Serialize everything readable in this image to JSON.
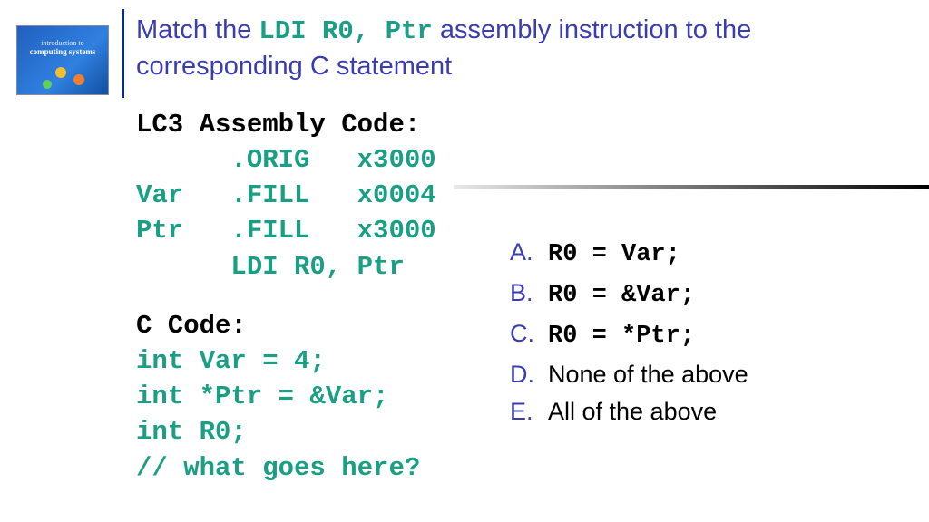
{
  "thumbnail": {
    "line1": "introduction to",
    "line2": "computing systems"
  },
  "heading": {
    "prefix": "Match the ",
    "code": "LDI R0, Ptr",
    "suffix": " assembly instruction to the corresponding C statement"
  },
  "asm": {
    "title": "LC3 Assembly Code:",
    "l1": "      .ORIG   x3000",
    "l2": "Var   .FILL   x0004",
    "l3": "Ptr   .FILL   x3000",
    "l4": "      LDI R0, Ptr"
  },
  "ccode": {
    "title": "C Code:",
    "l1": "int Var = 4;",
    "l2": "int *Ptr = &Var;",
    "l3": "int R0;",
    "l4": "// what goes here?"
  },
  "options": {
    "a": {
      "letter": "A.",
      "text": "R0 = Var;"
    },
    "b": {
      "letter": "B.",
      "text": "R0 = &Var;"
    },
    "c": {
      "letter": "C.",
      "text": "R0 = *Ptr;"
    },
    "d": {
      "letter": "D.",
      "text": "None of the above"
    },
    "e": {
      "letter": "E.",
      "text": "All of the above"
    }
  }
}
